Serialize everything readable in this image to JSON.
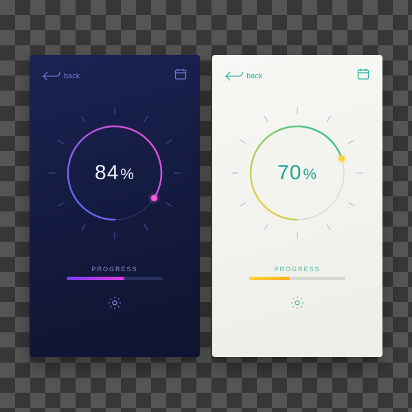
{
  "screens": {
    "dark": {
      "back_label": "back",
      "percent_value": "84",
      "percent_symbol": "%",
      "progress_label": "PROGRESS",
      "circle_fraction": 0.84,
      "bar_fraction": 0.6,
      "colors": {
        "ring_start": "#4a6bff",
        "ring_end": "#ff4ad6",
        "glow": "#ff56e0"
      }
    },
    "light": {
      "back_label": "back",
      "percent_value": "70",
      "percent_symbol": "%",
      "progress_label": "PROGRESS",
      "circle_fraction": 0.7,
      "bar_fraction": 0.42,
      "colors": {
        "ring_start": "#1fbf9e",
        "ring_end": "#ffd43a",
        "glow": "#ffd43a"
      }
    }
  },
  "icons": {
    "back": "back-arrow-icon",
    "calendar": "calendar-icon",
    "gear": "gear-icon"
  }
}
